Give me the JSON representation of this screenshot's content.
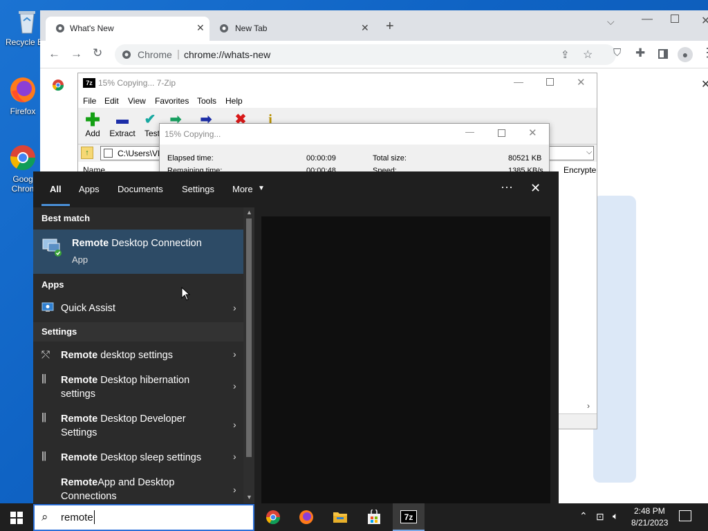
{
  "desktop": {
    "icons": [
      {
        "label": "Recycle Bin",
        "shown": "Recycle B"
      },
      {
        "label": "Firefox",
        "shown": "Firefox"
      },
      {
        "label": "Google Chrome",
        "shown_line1": "Goog",
        "shown_line2": "Chron"
      }
    ]
  },
  "chrome": {
    "tabs": [
      {
        "title": "What's New"
      },
      {
        "title": "New Tab"
      }
    ],
    "omnibox": {
      "site": "Chrome",
      "url": "chrome://whats-new"
    }
  },
  "zip": {
    "title": "15% Copying... 7-Zip",
    "menu": [
      "File",
      "Edit",
      "View",
      "Favorites",
      "Tools",
      "Help"
    ],
    "tools": [
      "Add",
      "Extract",
      "Test"
    ],
    "path": "C:\\Users\\VM",
    "columns": {
      "name": "Name",
      "encrypted": "Encrypte"
    }
  },
  "copy_dialog": {
    "title": "15% Copying...",
    "elapsed_label": "Elapsed time:",
    "elapsed_value": "00:00:09",
    "remaining_label": "Remaining time:",
    "remaining_value": "00:00:48",
    "total_label": "Total size:",
    "total_value": "80521 KB",
    "speed_label": "Speed:",
    "speed_value": "1385 KB/s"
  },
  "search": {
    "tabs": [
      "All",
      "Apps",
      "Documents",
      "Settings",
      "More"
    ],
    "best_match_header": "Best match",
    "best_match": {
      "bold": "Remote",
      "rest": " Desktop Connection",
      "sub": "App"
    },
    "apps_header": "Apps",
    "apps": [
      {
        "label": "Quick Assist"
      }
    ],
    "settings_header": "Settings",
    "settings": [
      {
        "bold": "Remote",
        "rest": " desktop settings",
        "line2": ""
      },
      {
        "bold": "Remote",
        "rest": " Desktop hibernation",
        "line2": "settings"
      },
      {
        "bold": "Remote",
        "rest": " Desktop Developer",
        "line2": "Settings"
      },
      {
        "bold": "Remote",
        "rest": " Desktop sleep settings",
        "line2": ""
      },
      {
        "bold": "Remote",
        "rest": "App and Desktop",
        "line2": "Connections"
      }
    ],
    "query": "remote"
  },
  "taskbar": {
    "time": "2:48 PM",
    "date": "8/21/2023"
  },
  "colors": {
    "accent": "#2b6fd8",
    "best_match_bg": "#2d4b66",
    "zip_red": "#d81818",
    "zip_green": "#14a014"
  }
}
